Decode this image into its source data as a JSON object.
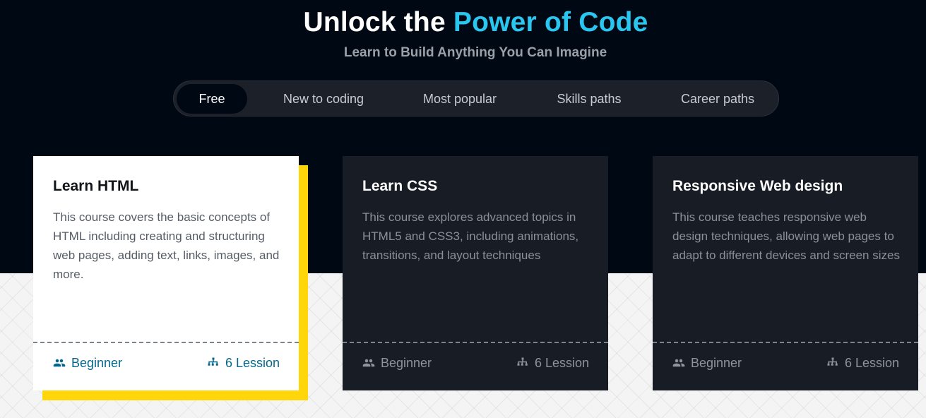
{
  "hero": {
    "title_plain": "Unlock the",
    "title_accent": "Power of Code",
    "subtitle": "Learn to Build Anything You Can Imagine"
  },
  "tabs": [
    {
      "label": "Free",
      "active": true
    },
    {
      "label": "New to coding",
      "active": false
    },
    {
      "label": "Most popular",
      "active": false
    },
    {
      "label": "Skills paths",
      "active": false
    },
    {
      "label": "Career paths",
      "active": false
    }
  ],
  "courses": [
    {
      "title": "Learn HTML",
      "description": "This course covers the basic concepts of HTML including creating and structuring web pages, adding text, links, images, and more.",
      "level": "Beginner",
      "lessons": "6 Lession",
      "highlighted": true
    },
    {
      "title": "Learn CSS",
      "description": "This course explores advanced topics in HTML5 and CSS3, including animations, transitions, and layout techniques",
      "level": "Beginner",
      "lessons": "6 Lession",
      "highlighted": false
    },
    {
      "title": "Responsive Web design",
      "description": "This course teaches responsive web design techniques, allowing web pages to adapt to different devices and screen sizes",
      "level": "Beginner",
      "lessons": "6 Lession",
      "highlighted": false
    }
  ],
  "colors": {
    "background": "#000814",
    "accent": "#29c6ef",
    "highlight": "#ffd60a",
    "link": "#05668d",
    "card_dark": "#181c25"
  },
  "icons": {
    "level": "users-icon",
    "lessons": "sitemap-icon"
  }
}
